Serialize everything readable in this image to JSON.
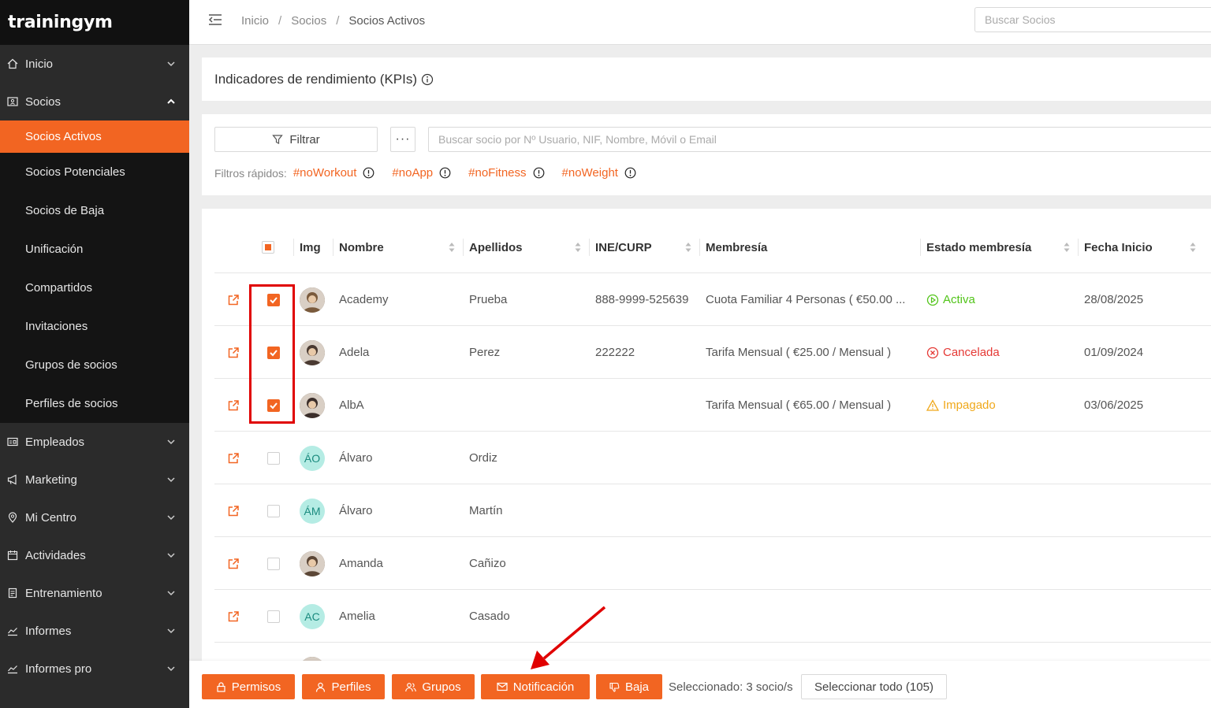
{
  "brand": {
    "logo_text": "trainingym"
  },
  "sidebar": {
    "items": [
      {
        "label": "Inicio",
        "icon": "home-icon"
      },
      {
        "label": "Socios",
        "icon": "id-card-icon",
        "expanded": true
      },
      {
        "label": "Empleados",
        "icon": "badge-icon"
      },
      {
        "label": "Marketing",
        "icon": "megaphone-icon"
      },
      {
        "label": "Mi Centro",
        "icon": "location-pin-icon"
      },
      {
        "label": "Actividades",
        "icon": "calendar-icon"
      },
      {
        "label": "Entrenamiento",
        "icon": "clipboard-icon"
      },
      {
        "label": "Informes",
        "icon": "chart-line-icon"
      },
      {
        "label": "Informes pro",
        "icon": "chart-line-icon"
      }
    ],
    "socios_sub": [
      {
        "label": "Socios Activos",
        "active": true
      },
      {
        "label": "Socios Potenciales"
      },
      {
        "label": "Socios de Baja"
      },
      {
        "label": "Unificación"
      },
      {
        "label": "Compartidos"
      },
      {
        "label": "Invitaciones"
      },
      {
        "label": "Grupos de socios"
      },
      {
        "label": "Perfiles de socios"
      }
    ]
  },
  "header": {
    "breadcrumb": [
      "Inicio",
      "Socios",
      "Socios Activos"
    ],
    "breadcrumb_sep": "/",
    "search_placeholder": "Buscar Socios"
  },
  "kpi": {
    "title": "Indicadores de rendimiento (KPIs)"
  },
  "filters": {
    "filter_button": "Filtrar",
    "more_button": "···",
    "search_placeholder": "Buscar socio por Nº Usuario, NIF, Nombre, Móvil o Email",
    "quick_label": "Filtros rápidos:",
    "quick": [
      "#noWorkout",
      "#noApp",
      "#noFitness",
      "#noWeight"
    ]
  },
  "table": {
    "columns": [
      "Img",
      "Nombre",
      "Apellidos",
      "INE/CURP",
      "Membresía",
      "Estado membresía",
      "Fecha Inicio"
    ],
    "rows": [
      {
        "checked": true,
        "avatar": "photo",
        "initials": "",
        "nombre": "Academy",
        "apellidos": "Prueba",
        "ine": "888-9999-525639",
        "membresia": "Cuota Familiar 4 Personas ( €50.00 ...",
        "estado": "Activa",
        "estado_type": "activa",
        "fecha": "28/08/2025"
      },
      {
        "checked": true,
        "avatar": "photo",
        "initials": "",
        "nombre": "Adela",
        "apellidos": "Perez",
        "ine": "222222",
        "membresia": "Tarifa Mensual ( €25.00 / Mensual )",
        "estado": "Cancelada",
        "estado_type": "cancel",
        "fecha": "01/09/2024"
      },
      {
        "checked": true,
        "avatar": "photo",
        "initials": "",
        "nombre": "AlbA",
        "apellidos": "",
        "ine": "",
        "membresia": "Tarifa Mensual ( €65.00 / Mensual )",
        "estado": "Impagado",
        "estado_type": "impag",
        "fecha": "03/06/2025"
      },
      {
        "checked": false,
        "avatar": "init",
        "initials": "ÁO",
        "nombre": "Álvaro",
        "apellidos": "Ordiz",
        "ine": "",
        "membresia": "",
        "estado": "",
        "estado_type": "",
        "fecha": ""
      },
      {
        "checked": false,
        "avatar": "init",
        "initials": "ÁM",
        "nombre": "Álvaro",
        "apellidos": "Martín",
        "ine": "",
        "membresia": "",
        "estado": "",
        "estado_type": "",
        "fecha": ""
      },
      {
        "checked": false,
        "avatar": "photo",
        "initials": "",
        "nombre": "Amanda",
        "apellidos": "Cañizo",
        "ine": "",
        "membresia": "",
        "estado": "",
        "estado_type": "",
        "fecha": ""
      },
      {
        "checked": false,
        "avatar": "init",
        "initials": "AC",
        "nombre": "Amelia",
        "apellidos": "Casado",
        "ine": "",
        "membresia": "",
        "estado": "",
        "estado_type": "",
        "fecha": ""
      },
      {
        "checked": false,
        "avatar": "photo",
        "initials": "",
        "nombre": "",
        "apellidos": "",
        "ine": "",
        "membresia": "",
        "estado": "",
        "estado_type": "",
        "fecha": ""
      }
    ]
  },
  "actions": {
    "buttons": [
      {
        "label": "Permisos",
        "icon": "lock-icon"
      },
      {
        "label": "Perfiles",
        "icon": "user-icon"
      },
      {
        "label": "Grupos",
        "icon": "users-icon"
      },
      {
        "label": "Notificación",
        "icon": "envelope-icon"
      },
      {
        "label": "Baja",
        "icon": "thumbs-down-icon"
      }
    ],
    "selected_text": "Seleccionado: 3 socio/s",
    "select_all": "Seleccionar todo (105)"
  },
  "colors": {
    "accent": "#f26522",
    "sidebar_bg": "#2b2b2b",
    "active": "#52c41a",
    "cancel": "#e53935",
    "warning": "#f0a81a",
    "annotation": "#e00000"
  }
}
